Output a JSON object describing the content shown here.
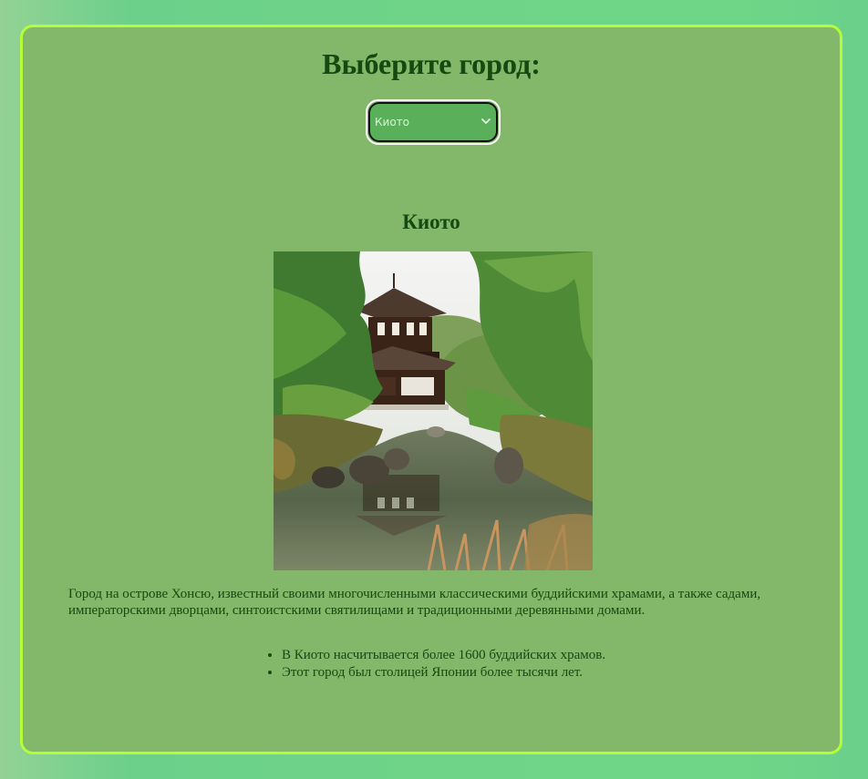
{
  "heading": "Выберите город:",
  "select": {
    "selected": "Киото",
    "options": [
      "Киото"
    ]
  },
  "city": {
    "name": "Киото",
    "image_alt": "Золотой павильон среди сада с прудом",
    "description": "Город на острове Хонсю, известный своими многочисленными классическими буддийскими храмами, а также садами, императорскими дворцами, синтоистскими святилищами и традиционными деревянными домами.",
    "facts": [
      "В Киото насчитывается более 1600 буддийских храмов.",
      "Этот город был столицей Японии более тысячи лет."
    ]
  },
  "colors": {
    "panel_bg": "#83b86b",
    "panel_border": "#b3ff3a",
    "text": "#14490f",
    "select_bg": "#5aaf5a"
  },
  "icons": {
    "select_arrow": "chevron-down-icon"
  }
}
